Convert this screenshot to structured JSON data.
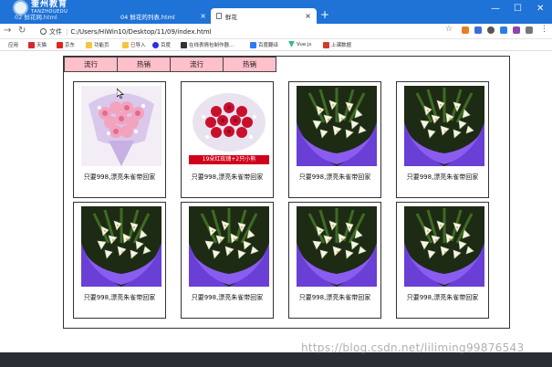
{
  "browser": {
    "logo": {
      "name": "奎州教育",
      "sub": "TANZHOUEDU"
    },
    "tabs": [
      {
        "title": "02 鲜花网.html"
      },
      {
        "title": "04 鲜花的列表.html"
      },
      {
        "title": "鲜花"
      }
    ],
    "new_tab": "+",
    "window_controls": {
      "min": "—",
      "max": "☐",
      "close": "✕"
    },
    "address": {
      "scheme_label": "文件",
      "url": "C:/Users/HiWin10/Desktop/11/09/index.html"
    },
    "bookmarks": [
      {
        "label": "应用",
        "color": "#ffffff"
      },
      {
        "label": "天猫",
        "color": "#d8272e"
      },
      {
        "label": "京东",
        "color": "#e1251b"
      },
      {
        "label": "功能页",
        "color": "#f5c542"
      },
      {
        "label": "已导入",
        "color": "#f5c542"
      },
      {
        "label": "百度",
        "color": "#2932e1"
      },
      {
        "label": "在线表情包制作器...",
        "color": "#333333"
      },
      {
        "label": "百度翻译",
        "color": "#2d7cf6"
      },
      {
        "label": "Vue.js",
        "color": "#41b883"
      },
      {
        "label": "上课数据",
        "color": "#d33b2c"
      }
    ],
    "accent": "#1f72d6"
  },
  "page": {
    "nav": [
      "流行",
      "热销",
      "流行",
      "热销"
    ],
    "products": [
      {
        "caption": "只要998,漂亮朱雀带回家",
        "image": "pink-bouquet"
      },
      {
        "caption": "只要998,漂亮朱雀带回家",
        "image": "red-rose-bouquet",
        "banner": "19朵红玫瑰+2只小熊"
      },
      {
        "caption": "只要998,漂亮朱雀带回家",
        "image": "lily-bouquet"
      },
      {
        "caption": "只要998,漂亮朱雀带回家",
        "image": "lily-bouquet"
      },
      {
        "caption": "只要998,漂亮朱雀带回家",
        "image": "lily-bouquet"
      },
      {
        "caption": "只要998,漂亮朱雀带回家",
        "image": "lily-bouquet"
      },
      {
        "caption": "只要998,漂亮朱雀带回家",
        "image": "lily-bouquet"
      },
      {
        "caption": "只要998,漂亮朱雀带回家",
        "image": "lily-bouquet"
      }
    ],
    "nav_color": "#ffc0cb"
  },
  "watermark": "https://blog.csdn.net/liliming99876543"
}
